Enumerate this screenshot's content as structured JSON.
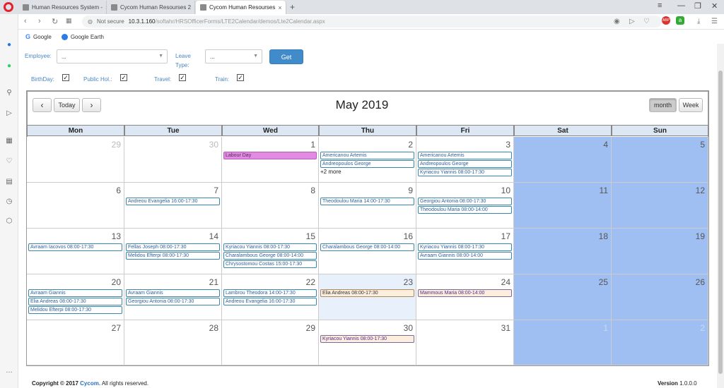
{
  "browser": {
    "tabs": [
      {
        "label": "Human Resources System -",
        "close": "×"
      },
      {
        "label": "Cycom Human Resourses 2",
        "close": "×"
      },
      {
        "label": "Cycom Human Resourses",
        "close": "×"
      }
    ],
    "new_tab": "+",
    "url_security": "Not secure",
    "url_host": "10.3.1.160",
    "url_path": "/softahr/HRSOfficerForms/LTE2Calendar/demos/Lte2Calendar.aspx",
    "bookmarks": [
      {
        "label": "Google"
      },
      {
        "label": "Google Earth"
      }
    ]
  },
  "filters": {
    "employee_label": "Employee:",
    "employee_value": "...",
    "leave_type_label_1": "Leave",
    "leave_type_label_2": "Type:",
    "leave_type_value": "...",
    "get_label": "Get",
    "checkboxes": [
      {
        "label": "BirthDay:",
        "checked": true
      },
      {
        "label": "Public Hol.:",
        "checked": true
      },
      {
        "label": "Travel:",
        "checked": true
      },
      {
        "label": "Train:",
        "checked": true
      }
    ]
  },
  "calendar": {
    "title": "May 2019",
    "prev_label": "‹",
    "next_label": "›",
    "today_label": "Today",
    "view_month": "month",
    "view_week": "Week",
    "day_headers": [
      "Mon",
      "Tue",
      "Wed",
      "Thu",
      "Fri",
      "Sat",
      "Sun"
    ],
    "weeks": [
      {
        "days": [
          {
            "n": "29",
            "other": true,
            "events": []
          },
          {
            "n": "30",
            "other": true,
            "events": []
          },
          {
            "n": "1",
            "events": [
              {
                "t": "Labour Day",
                "s": "pink"
              }
            ]
          },
          {
            "n": "2",
            "events": [
              {
                "t": "Americanou Artemis"
              },
              {
                "t": "Andreopoulos George"
              }
            ],
            "more": "+2 more"
          },
          {
            "n": "3",
            "events": [
              {
                "t": "Americanou Artemis"
              },
              {
                "t": "Andreopoulos George"
              },
              {
                "t": "Kyriacou Yiannis 08:00-17:30"
              }
            ]
          },
          {
            "n": "4",
            "events": []
          },
          {
            "n": "5",
            "events": []
          }
        ]
      },
      {
        "days": [
          {
            "n": "6",
            "events": []
          },
          {
            "n": "7",
            "events": [
              {
                "t": "Andreou Evangelia 16:00-17:30"
              }
            ]
          },
          {
            "n": "8",
            "events": []
          },
          {
            "n": "9",
            "events": [
              {
                "t": "Theodoulou Maria 14:00-17:30"
              }
            ]
          },
          {
            "n": "10",
            "events": [
              {
                "t": "Georgiou Antonia 08:00-17:30"
              },
              {
                "t": "Theodoulou Maria 08:00-14:00"
              }
            ]
          },
          {
            "n": "11",
            "events": []
          },
          {
            "n": "12",
            "events": []
          }
        ]
      },
      {
        "days": [
          {
            "n": "13",
            "events": [
              {
                "t": "Avraam Iacovos 08:00-17:30"
              }
            ]
          },
          {
            "n": "14",
            "events": [
              {
                "t": "Fellas Joseph 08:00-17:30"
              },
              {
                "t": "Melidou Efterpi 08:00-17:30"
              }
            ]
          },
          {
            "n": "15",
            "events": [
              {
                "t": "Kyriacou Yiannis 08:00-17:30"
              },
              {
                "t": "Charalambous George 08:00-14:00"
              },
              {
                "t": "Chrysostomou Costas 15:00-17:30"
              }
            ]
          },
          {
            "n": "16",
            "events": [
              {
                "t": "Charalambous George 08:00-14:00"
              }
            ]
          },
          {
            "n": "17",
            "events": [
              {
                "t": "Kyriacou Yiannis 08:00-17:30"
              },
              {
                "t": "Avraam Giannis 08:00-14:00"
              }
            ]
          },
          {
            "n": "18",
            "events": []
          },
          {
            "n": "19",
            "events": []
          }
        ]
      },
      {
        "days": [
          {
            "n": "20",
            "events": [
              {
                "t": "Avraam Giannis"
              },
              {
                "t": "Elia Andreas 08:00-17:30"
              },
              {
                "t": "Melidou Efterpi 08:00-17:30"
              }
            ]
          },
          {
            "n": "21",
            "events": [
              {
                "t": "Avraam Giannis"
              },
              {
                "t": "Georgiou Antonia 08:00-17:30"
              }
            ]
          },
          {
            "n": "22",
            "events": [
              {
                "t": "Lambrou Theodora 14:00-17:30"
              },
              {
                "t": "Andreou Evangelia 16:00-17:30"
              }
            ]
          },
          {
            "n": "23",
            "today": true,
            "events": [
              {
                "t": "Elia Andreas 08:00-17:30",
                "s": "cream"
              }
            ]
          },
          {
            "n": "24",
            "events": [
              {
                "t": "Mammous Maria 08:00-14:00",
                "s": "cream2"
              }
            ]
          },
          {
            "n": "25",
            "events": []
          },
          {
            "n": "26",
            "events": []
          }
        ]
      },
      {
        "days": [
          {
            "n": "27",
            "events": []
          },
          {
            "n": "28",
            "events": []
          },
          {
            "n": "29",
            "events": []
          },
          {
            "n": "30",
            "events": [
              {
                "t": "Kyriacou Yiannis 08:00-17:30",
                "s": "cream2"
              }
            ]
          },
          {
            "n": "31",
            "events": []
          },
          {
            "n": "1",
            "other": true,
            "events": []
          },
          {
            "n": "2",
            "other": true,
            "events": []
          }
        ]
      }
    ]
  },
  "footer": {
    "copyright_prefix": "Copyright © 2017",
    "brand": "Cycom.",
    "rights": "All rights reserved.",
    "version_label": "Version",
    "version": "1.0.0.0"
  },
  "colors": {
    "weekend": "#9fbff2",
    "event_border": "#3a87ad",
    "holiday": "#e28be3",
    "primary": "#428bca"
  }
}
